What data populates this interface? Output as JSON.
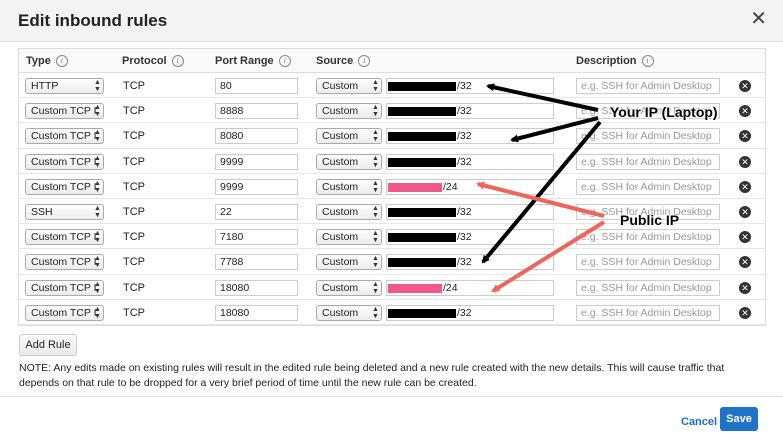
{
  "dialog": {
    "title": "Edit inbound rules",
    "close_icon": "close-icon"
  },
  "columns": {
    "type": "Type",
    "protocol": "Protocol",
    "port_range": "Port Range",
    "source": "Source",
    "description": "Description"
  },
  "rules": [
    {
      "type": "HTTP",
      "protocol": "TCP",
      "port": "80",
      "source": "Custom",
      "cidr": "/32",
      "ip_mask": "black",
      "desc_placeholder": "e.g. SSH for Admin Desktop"
    },
    {
      "type": "Custom TCP I",
      "protocol": "TCP",
      "port": "8888",
      "source": "Custom",
      "cidr": "/32",
      "ip_mask": "black",
      "desc_placeholder": "e.g. SSH for Admin Desktop"
    },
    {
      "type": "Custom TCP I",
      "protocol": "TCP",
      "port": "8080",
      "source": "Custom",
      "cidr": "/32",
      "ip_mask": "black",
      "desc_placeholder": "e.g. SSH for Admin Desktop"
    },
    {
      "type": "Custom TCP I",
      "protocol": "TCP",
      "port": "9999",
      "source": "Custom",
      "cidr": "/32",
      "ip_mask": "black",
      "desc_placeholder": "e.g. SSH for Admin Desktop"
    },
    {
      "type": "Custom TCP I",
      "protocol": "TCP",
      "port": "9999",
      "source": "Custom",
      "cidr": "/24",
      "ip_mask": "pink",
      "desc_placeholder": "e.g. SSH for Admin Desktop"
    },
    {
      "type": "SSH",
      "protocol": "TCP",
      "port": "22",
      "source": "Custom",
      "cidr": "/32",
      "ip_mask": "black",
      "desc_placeholder": "e.g. SSH for Admin Desktop"
    },
    {
      "type": "Custom TCP I",
      "protocol": "TCP",
      "port": "7180",
      "source": "Custom",
      "cidr": "/32",
      "ip_mask": "black",
      "desc_placeholder": "e.g. SSH for Admin Desktop"
    },
    {
      "type": "Custom TCP I",
      "protocol": "TCP",
      "port": "7788",
      "source": "Custom",
      "cidr": "/32",
      "ip_mask": "black",
      "desc_placeholder": "e.g. SSH for Admin Desktop"
    },
    {
      "type": "Custom TCP I",
      "protocol": "TCP",
      "port": "18080",
      "source": "Custom",
      "cidr": "/24",
      "ip_mask": "pink",
      "desc_placeholder": "e.g. SSH for Admin Desktop"
    },
    {
      "type": "Custom TCP I",
      "protocol": "TCP",
      "port": "18080",
      "source": "Custom",
      "cidr": "/32",
      "ip_mask": "black",
      "desc_placeholder": "e.g. SSH for Admin Desktop"
    }
  ],
  "add_rule_label": "Add Rule",
  "note": "NOTE: Any edits made on existing rules will result in the edited rule being deleted and a new rule created with the new details. This will cause traffic that depends on that rule to be dropped for a very brief period of time until the new rule can be created.",
  "footer": {
    "cancel_label": "Cancel",
    "save_label": "Save"
  },
  "annotations": {
    "your_ip": "Your IP (Laptop)",
    "public_ip": "Public IP"
  },
  "colors": {
    "black_arrow": "#000000",
    "red_arrow": "#f0645a",
    "pink_mask": "#f0588a",
    "save_button": "#1f73c8",
    "cancel_link": "#1a6fc9"
  }
}
